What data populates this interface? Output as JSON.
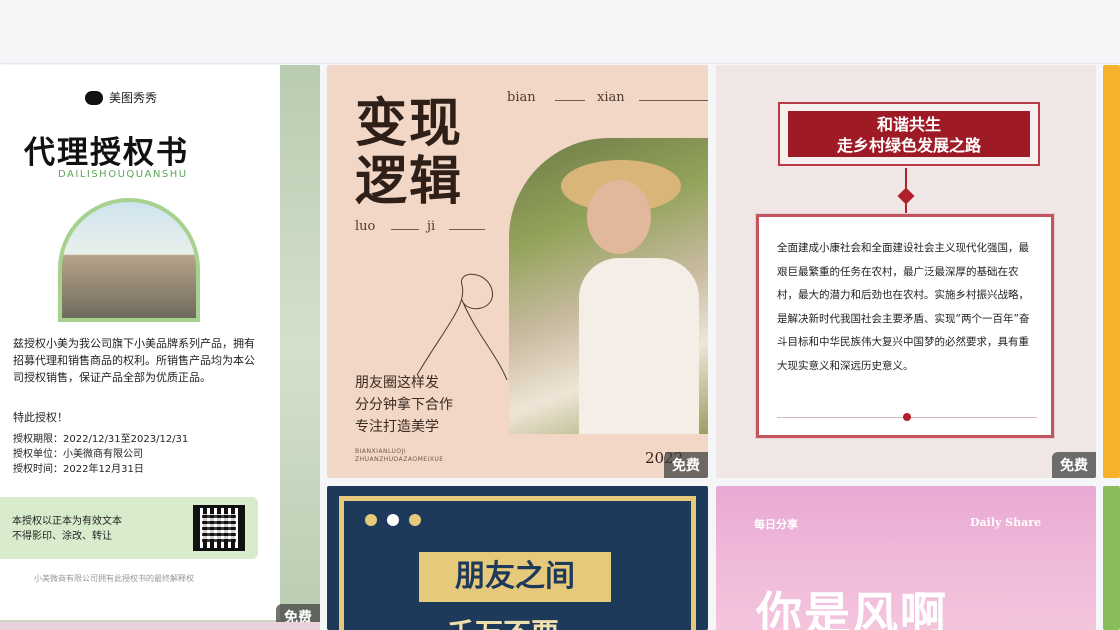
{
  "cards": [
    {
      "brand": "美图秀秀",
      "title": "代理授权书",
      "subtitle": "DAILISHOUQUANSHU",
      "body": "兹授权小美为我公司旗下小美品牌系列产品，拥有招募代理和销售商品的权利。所销售产品均为本公司授权销售，保证产品全部为优质正品。",
      "special": "特此授权！",
      "info": [
        "授权期限：2022/12/31至2023/12/31",
        "授权单位：小美微商有限公司",
        "授权时间：2022年12月31日"
      ],
      "note": [
        "本授权以正本为有效文本",
        "不得影印、涂改、转让"
      ],
      "footer": "小美微商有限公司拥有此授权书的最终解释权",
      "badge": "免费"
    },
    {
      "title_lines": [
        "变现",
        "逻辑"
      ],
      "pinyin_top": [
        "bian",
        "xian"
      ],
      "pinyin_mid": [
        "luo",
        "ji"
      ],
      "lines": [
        "朋友圈这样发",
        "分分钟拿下合作",
        "专注打造美学"
      ],
      "tiny": [
        "BIANXIANLUOJI",
        "ZHUANZHUDAZAOMEIXUE"
      ],
      "year": "2022",
      "badge": "免费"
    },
    {
      "banner": [
        "和谐共生",
        "走乡村绿色发展之路"
      ],
      "text": "全面建成小康社会和全面建设社会主义现代化强国，最艰巨最繁重的任务在农村，最广泛最深厚的基础在农村，最大的潜力和后劲也在农村。实施乡村振兴战略，是解决新时代我国社会主要矛盾、实现“两个一百年”奋斗目标和中华民族伟大复兴中国梦的必然要求，具有重大现实意义和深远历史意义。",
      "badge": "免费"
    },
    {
      "label": "朋友之间",
      "cut_text": "千万不要"
    },
    {
      "left": "每日分享",
      "right": "Daily Share",
      "big": "你是风啊"
    }
  ],
  "colors": {
    "accent_red": "#9e1a25",
    "gold": "#e7c97c",
    "navy": "#1e3a5a"
  }
}
